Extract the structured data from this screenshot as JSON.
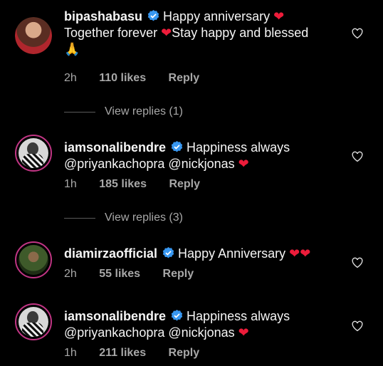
{
  "comments": [
    {
      "username": "bipashabasu",
      "text_a": "Happy anniversary ",
      "heart": "❤",
      "text_b": "Together forever ",
      "heart2": "❤",
      "text_c": "Stay happy and blessed",
      "emoji": "🙏",
      "time": "2h",
      "likes": "110 likes",
      "reply": "Reply"
    },
    {
      "username": "iamsonalibendre",
      "text_a": "Happiness always",
      "text_b": "@priyankachopra @nickjonas ",
      "heart": "❤",
      "time": "1h",
      "likes": "185 likes",
      "reply": "Reply"
    },
    {
      "username": "diamirzaofficial",
      "text_a": "Happy Anniversary ",
      "hearts": "❤❤",
      "time": "2h",
      "likes": "55 likes",
      "reply": "Reply"
    },
    {
      "username": "iamsonalibendre",
      "text_a": "Happiness always",
      "text_b": "@priyankachopra @nickjonas ",
      "heart": "❤",
      "time": "1h",
      "likes": "211 likes",
      "reply": "Reply"
    }
  ],
  "view_replies": [
    "View replies (1)",
    "View replies (3)"
  ],
  "icons": {
    "like": "heart-outline-icon",
    "verified": "verified-badge-icon"
  },
  "colors": {
    "background": "#000000",
    "accent_verified": "#3897f0",
    "heart": "#ed1c3a",
    "story_ring": "#c13584"
  }
}
